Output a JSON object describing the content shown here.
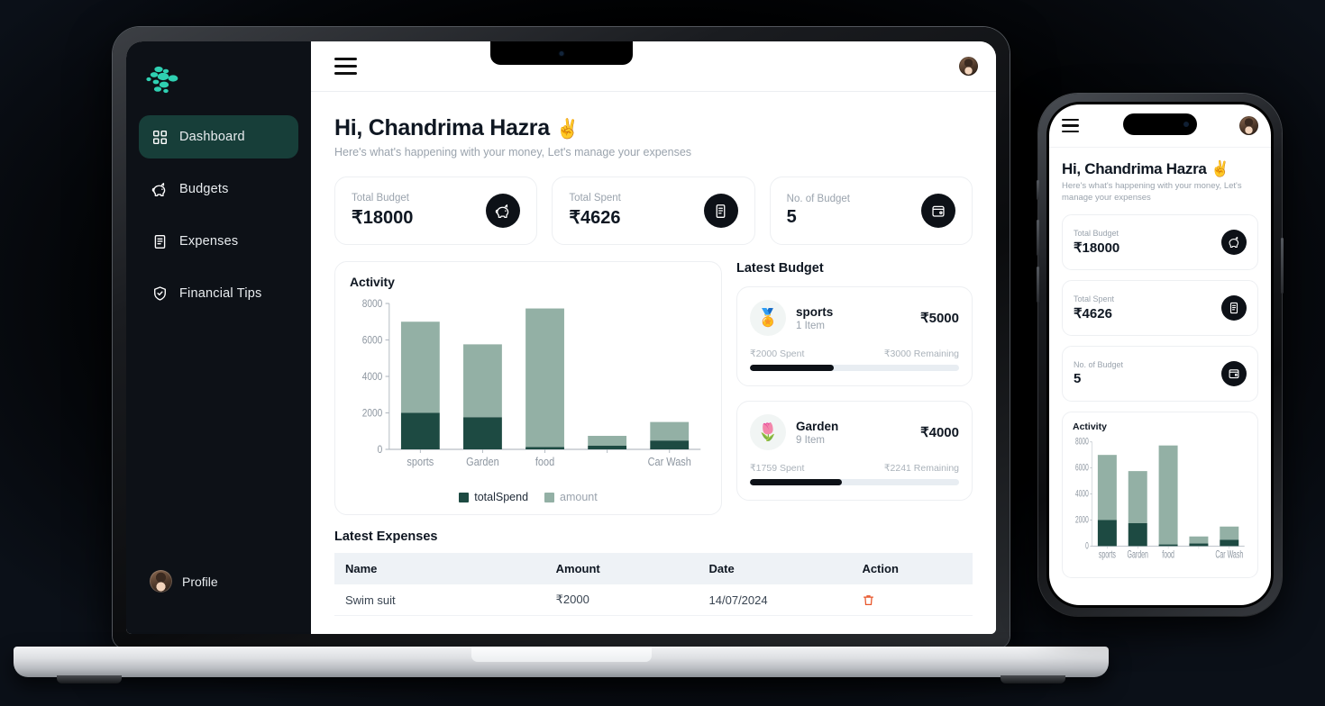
{
  "brand": {
    "logo_name": "dotted-arrow-logo",
    "accent": "#2fd0b2"
  },
  "sidebar": {
    "items": [
      {
        "label": "Dashboard",
        "icon": "grid-icon",
        "active": true
      },
      {
        "label": "Budgets",
        "icon": "piggy-bank-icon",
        "active": false
      },
      {
        "label": "Expenses",
        "icon": "receipt-icon",
        "active": false
      },
      {
        "label": "Financial Tips",
        "icon": "shield-check-icon",
        "active": false
      }
    ],
    "profile": {
      "label": "Profile",
      "avatar": "user-avatar"
    }
  },
  "topbar": {
    "menu_icon": "hamburger-icon",
    "avatar": "user-avatar"
  },
  "header": {
    "greeting": "Hi, Chandrima Hazra",
    "emoji": "✌️",
    "subtitle": "Here's what's happening with your money, Let's manage your expenses"
  },
  "stat_cards": [
    {
      "label": "Total Budget",
      "value": "₹18000",
      "icon": "piggy-bank-icon"
    },
    {
      "label": "Total Spent",
      "value": "₹4626",
      "icon": "receipt-icon"
    },
    {
      "label": "No. of Budget",
      "value": "5",
      "icon": "wallet-icon"
    }
  ],
  "activity": {
    "title": "Activity"
  },
  "chart_data": {
    "type": "bar",
    "stacked": true,
    "title": "Activity",
    "categories": [
      "sports",
      "Garden",
      "food",
      "",
      "Car Wash"
    ],
    "tick_labels_shown": [
      "sports",
      "Garden",
      "food",
      "Car Wash"
    ],
    "series": [
      {
        "name": "totalSpend",
        "color": "#1d4a42",
        "values": [
          2000,
          1759,
          126,
          200,
          480
        ]
      },
      {
        "name": "amount",
        "color": "#93b0a5",
        "values": [
          5000,
          4000,
          7600,
          540,
          1020
        ]
      }
    ],
    "ylabel": "",
    "xlabel": "",
    "ylim": [
      0,
      8000
    ],
    "yticks": [
      0,
      2000,
      4000,
      6000,
      8000
    ],
    "grid": false,
    "legend": [
      "totalSpend",
      "amount"
    ],
    "legend_position": "bottom"
  },
  "latest_budget": {
    "title": "Latest Budget",
    "items": [
      {
        "emoji": "🏅",
        "name": "sports",
        "items_count": "1 Item",
        "amount": "₹5000",
        "spent_label": "₹2000 Spent",
        "remaining_label": "₹3000 Remaining",
        "progress_pct": 40
      },
      {
        "emoji": "🌷",
        "name": "Garden",
        "items_count": "9 Item",
        "amount": "₹4000",
        "spent_label": "₹1759 Spent",
        "remaining_label": "₹2241 Remaining",
        "progress_pct": 44
      }
    ]
  },
  "latest_expenses": {
    "title": "Latest Expenses",
    "columns": [
      "Name",
      "Amount",
      "Date",
      "Action"
    ],
    "rows": [
      {
        "name": "Swim suit",
        "amount": "₹2000",
        "date": "14/07/2024",
        "action_icon": "trash-icon"
      }
    ]
  },
  "phone": {
    "header": {
      "greeting": "Hi, Chandrima Hazra",
      "emoji": "✌️",
      "subtitle": "Here's what's happening with your money, Let's manage your expenses"
    },
    "stat_cards": [
      {
        "label": "Total Budget",
        "value": "₹18000",
        "icon": "piggy-bank-icon"
      },
      {
        "label": "Total Spent",
        "value": "₹4626",
        "icon": "receipt-icon"
      },
      {
        "label": "No. of Budget",
        "value": "5",
        "icon": "wallet-icon"
      }
    ],
    "activity": {
      "title": "Activity"
    }
  }
}
